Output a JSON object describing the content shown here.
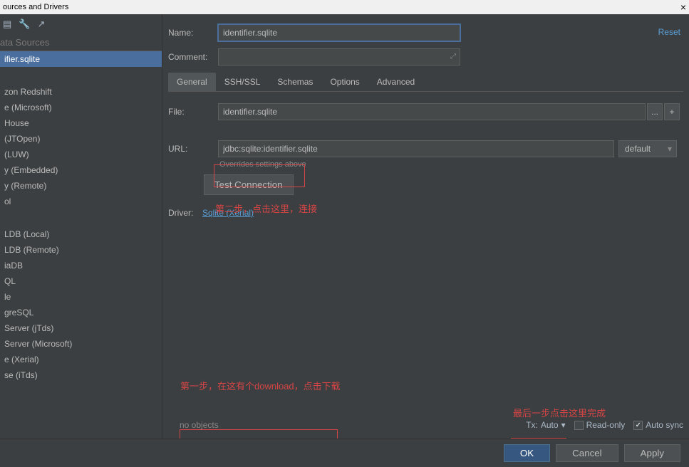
{
  "window": {
    "title": "ources and Drivers"
  },
  "toolbar_icons": {
    "database": "database-icon",
    "wrench": "wrench-icon",
    "chart": "chart-icon"
  },
  "sidebar": {
    "section_title": "ata Sources",
    "selected_item": "ifier.sqlite",
    "drivers": [
      "zon Redshift",
      "e (Microsoft)",
      "House",
      "(JTOpen)",
      "(LUW)",
      "y (Embedded)",
      "y (Remote)",
      "ol",
      "LDB (Local)",
      "LDB (Remote)",
      "iaDB",
      "QL",
      "le",
      "greSQL",
      "Server (jTds)",
      "Server (Microsoft)",
      "e (Xerial)",
      "se (iTds)"
    ]
  },
  "form": {
    "name_label": "Name:",
    "name_value": "identifier.sqlite",
    "comment_label": "Comment:",
    "reset_link": "Reset",
    "tabs": [
      "General",
      "SSH/SSL",
      "Schemas",
      "Options",
      "Advanced"
    ],
    "active_tab": "General",
    "file_label": "File:",
    "file_value": "identifier.sqlite",
    "browse_btn": "...",
    "add_btn": "+",
    "url_label": "URL:",
    "url_value": "jdbc:sqlite:identifier.sqlite",
    "url_mode": "default",
    "url_hint": "Overrides settings above",
    "test_btn": "Test Connection",
    "driver_label": "Driver:",
    "driver_link": "Sqlite (Xerial)"
  },
  "annotations": {
    "step2": "第二步，点击这里，连接",
    "step1": "第一步，在这有个download，点击下载",
    "final": "最后一步点击这里完成"
  },
  "bottom": {
    "no_objects": "no objects",
    "tx_label": "Tx:",
    "tx_value": "Auto",
    "readonly": "Read-only",
    "autosync": "Auto sync",
    "autosync_checked": true,
    "readonly_checked": false
  },
  "footer": {
    "ok": "OK",
    "cancel": "Cancel",
    "apply": "Apply"
  }
}
